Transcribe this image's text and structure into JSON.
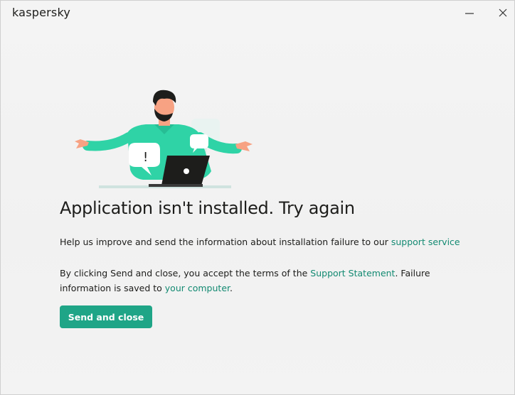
{
  "window": {
    "brand": "kaspersky",
    "minimize_icon": "minimize-icon",
    "close_icon": "close-icon"
  },
  "illustration": {
    "name": "person-shrugging-with-laptop",
    "exclamation_mark": "!"
  },
  "content": {
    "headline": "Application isn't installed. Try again",
    "help_text": "Help us improve and send the information about installation failure to our ",
    "help_link": "support service",
    "terms_prefix": "By clicking Send and close, you accept the terms of the ",
    "terms_link": "Support Statement",
    "terms_middle": ". Failure information is saved to ",
    "computer_link": "your computer",
    "terms_suffix": "."
  },
  "actions": {
    "send_label": "Send and close"
  },
  "colors": {
    "accent": "#1fa587",
    "link": "#138a72",
    "background": "#f2f2f2",
    "text": "#1d1d1b",
    "shirt": "#2fd3a6",
    "laptop": "#1d1d1b"
  }
}
